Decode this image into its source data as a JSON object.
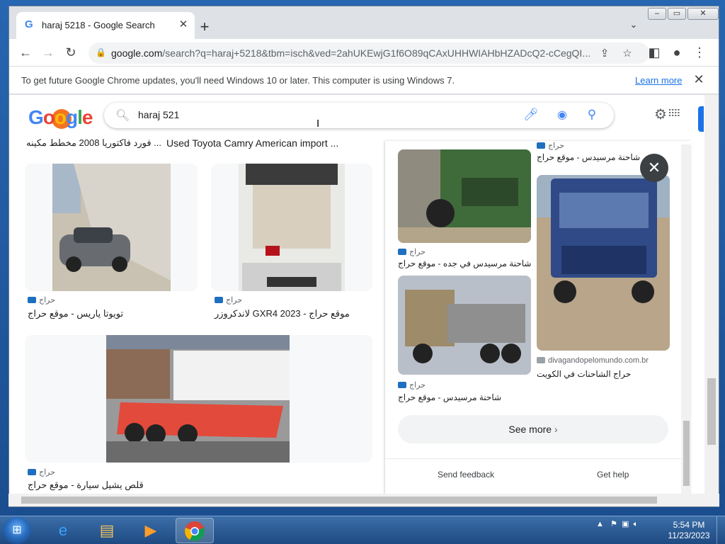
{
  "browser": {
    "tab_title": "haraj 5218 - Google Search",
    "tab_favicon": "G",
    "url_host": "google.com",
    "url_path": "/search?q=haraj+5218&tbm=isch&ved=2ahUKEwjG1f6O89qCAxUHHWIAHbHZADcQ2-cCegQI...",
    "infobar_text": "To get future Google Chrome updates, you'll need Windows 10 or later. This computer is using Windows 7.",
    "infobar_link": "Learn more"
  },
  "google": {
    "search_query": "haraj 521",
    "top_caption_left": "فورد فاكتوريا 2008 مخطط مكينه ...",
    "top_caption_right": "Used Toyota Camry American import ..."
  },
  "results": [
    {
      "source": "حراج",
      "caption": "تويوتا ياريس - موقع حراج"
    },
    {
      "source": "حراج",
      "caption": "لاندكروزر GXR4 2023 - موقع حراج"
    },
    {
      "source": "حراج",
      "caption": "قلص يشيل سيارة - موقع حراج"
    }
  ],
  "panel": {
    "top_source": "حراج",
    "top_caption": "شاحنة مرسيدس - موقع حراج",
    "items": [
      {
        "source": "حراج",
        "caption": "شاحنة مرسيدس في جده - موقع حراج"
      },
      {
        "source": "divagandopelomundo.com.br",
        "caption": "حراج الشاحنات في الكويت"
      },
      {
        "source": "حراج",
        "caption": "شاحنة مرسيدس - موقع حراج"
      }
    ],
    "see_more": "See more",
    "send_feedback": "Send feedback",
    "get_help": "Get help"
  },
  "taskbar": {
    "time": "5:54 PM",
    "date": "11/23/2023"
  },
  "colors": {
    "google_blue": "#4285f4",
    "link_blue": "#1a73e8",
    "chrome_frame": "#dee1e6"
  }
}
